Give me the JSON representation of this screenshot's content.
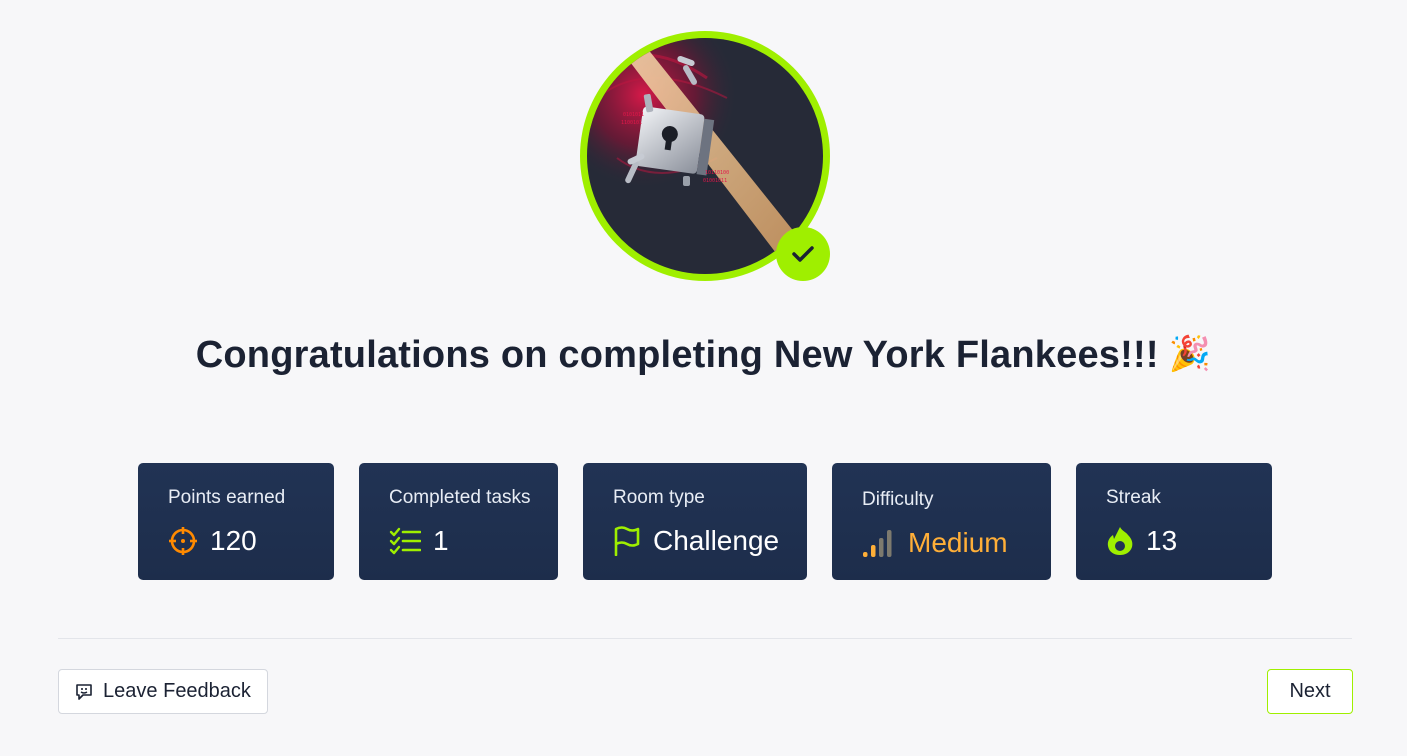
{
  "room": {
    "name": "New York Flankees",
    "badge_icon": "lock-breaking-icon",
    "completed": true
  },
  "title": {
    "text": "Congratulations on completing New York Flankees!!!",
    "emoji": "🎉"
  },
  "stats": {
    "points": {
      "label": "Points earned",
      "value": "120",
      "icon": "crosshair-icon",
      "color": "#ff8a00"
    },
    "tasks": {
      "label": "Completed tasks",
      "value": "1",
      "icon": "checklist-icon",
      "color": "#9fef00"
    },
    "room_type": {
      "label": "Room type",
      "value": "Challenge",
      "icon": "flag-icon",
      "color": "#9fef00"
    },
    "difficulty": {
      "label": "Difficulty",
      "value": "Medium",
      "icon": "signal-bars-icon",
      "color": "#ffaf38"
    },
    "streak": {
      "label": "Streak",
      "value": "13",
      "icon": "flame-icon",
      "color": "#9fef00"
    }
  },
  "footer": {
    "feedback_label": "Leave Feedback",
    "next_label": "Next"
  },
  "colors": {
    "accent": "#9fef00",
    "card_bg": "#213354",
    "page_bg": "#f7f7f9"
  }
}
